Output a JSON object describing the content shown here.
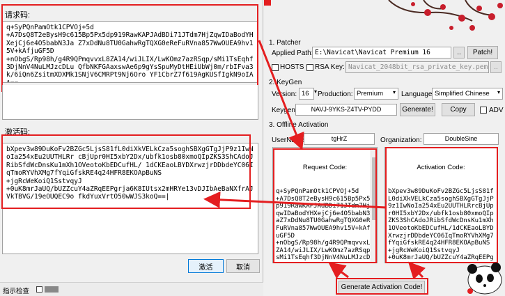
{
  "left_dialog": {
    "request_label": "请求码:",
    "request_code": "q+SyPQnPamOtk1CPVOj+5d\n+A7DsQ8T2eBysH9c615Bp5Px5dp919RawKAPJAdBDi71JTdm7HjZqwIDaBodYHXejCj6e4O5babN3Ja Z7xDdNu8TU0GahwRgTQXG0eReFuRVna857WwOUEA9hv15V+kAfjuGF5D\n+nObgS/Rp98h/g4R9QPmqvvxL8ZA14/wiJLIX/LwKOmz7azRSqp/sMi1TsEqhf3DjNnV4NuLMJzcDLu QfbNKFGAaxswAe6p9gYsSpuMyDtHEiUbWj0m/rbIFva3k/6iQn6ZsitmXDXMk1SNjV6CMRPt9Nj6Oro YF1CbrZ7f619AgKUSfIgkN9oIAA==",
    "activation_label": "激活码:",
    "activation_code": "bXpev3w89DuKoFv2BZGc5LjsS81fL0diXkVELkCza5soghSBXgGTgJjP9z1IwNoIa254xEu2UUTHLRr cBjUpr0HI5xbY2Dx/ubfk1osb80xmoQIpZKS3ShCAdoJRibSfdWcDnsKu1mXh1OVeotoKbEDCufHL/ 1dCKEaoLBYDXrwzjrDDbdeYC06IqTmoRYVhXMg7fYqiGfskRE4q24HFR8EKOApBuNS\n+jgRcWeKoiQ1SstvqyJ\n+0uK8mrJaUQ/bUZZcuY4aZRqEEPgrja6K8IUtsx2mHRYe13vDJIbAeBaNXfrAJVkTBVG/19eOUQEC9o fkdYuxVrtO50wWJS3koQ==|",
    "activate_button": "激活",
    "cancel_button": "取消"
  },
  "status_strip": {
    "text": "指示检查"
  },
  "patcher": {
    "section1": "1. Patcher",
    "applied_path_label": "Applied Path:",
    "applied_path_value": "E:\\Navicat\\Navicat Premium 16",
    "browse_button": "..",
    "patch_button": "Patch!",
    "hosts_label": "HOSTS",
    "rsa_label": "RSA Key:",
    "rsa_value": "Navicat_2048bit_rsa_private_key.pem",
    "rsa_browse_button": "..",
    "section2": "2. KeyGen",
    "version_label": "Version:",
    "version_value": "16",
    "production_label": "Production:",
    "production_value": "Premium",
    "language_label": "Language:",
    "language_value": "Simplified Chinese",
    "keygen_label": "Keygen",
    "keygen_value": "NAVJ-9YKS-Z4TV-PYDD",
    "generate_button": "Generate!",
    "copy_button": "Copy",
    "adv_label": "ADV",
    "section3": "3. Offline Activation",
    "username_label": "UserName:",
    "username_value": "tgHrZ",
    "organization_label": "Organization:",
    "organization_value": "DoubleSine",
    "request_code_title": "Request Code:",
    "request_code_text": "q+SyPQnPamOtk1CPVOj+5d\n+A7DsQ8T2eBysH9c615Bp5Px5dp919RawKAPJAdBDi71JTdm7HjZqwIDaBodYHXejCj6e4O5babN3JaZ7xDdNu8TU0GahwRgTQXG0eReFuRVna857WwOUEA9hv15V+kAfjuGF5D\n+nObgS/Rp98h/g4R9QPmqvvxL8ZA14/wiJLIX/LwKOmz7azRSqp/sMi1TsEqhf3DjNnV4NuLMJzcDLuQfbNKFGAaxswAe6p9gYsSpuMyDtHEiUbWj0m/rbIFva3k/6iQn6ZsitmXDXMk1SNjV6CMRPt9Nj6OroYF1CbrZ7f619AgKUSfIgkN9oIAA==",
    "activation_code_title": "Activation Code:",
    "activation_code_text": "bXpev3w89DuKoFv2BZGc5LjsS81fL0diXkVELkCza5soghSBXgGTgJjP9z1IwNoIa254xEu2UUTHLRrcBjUpr0HI5xbY2Dx/ubfk1osb80xmoQIpZKS3ShCAdoJRibSfdWcDnsKu1mXh1OVeotoKbEDCufHL/1dCKEaoLBYDXrwzjrDDbdeYC06IqTmoRYVhXMg7fYqiGfskRE4q24HFR8EKOApBuNS\n+jgRcWeKoiQ1SstvqyJ\n+0uK8mrJaUQ/bUZZcuY4aZRqEEPgrja6K8IUtsx2mHRYe13vDJIbAeBaNXfrAJVkTBVG/19eOUQEC9ofkdYuxVrtO50wWJS3koQ==",
    "generate_activation_button": "Generate Activation Code!"
  },
  "colors": {
    "highlight": "#e41e20",
    "blossom": "#c81e2c"
  }
}
